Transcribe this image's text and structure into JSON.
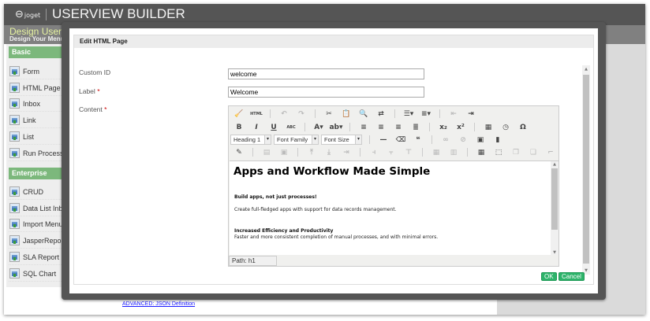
{
  "header": {
    "logo_text": "joget",
    "title": "USERVIEW BUILDER"
  },
  "subheader": {
    "title": "Design Userview",
    "subtitle": "Design Your Menu"
  },
  "sidebar": {
    "basic_label": "Basic",
    "basic_items": [
      {
        "label": "Form"
      },
      {
        "label": "HTML Page"
      },
      {
        "label": "Inbox"
      },
      {
        "label": "Link"
      },
      {
        "label": "List"
      },
      {
        "label": "Run Process"
      }
    ],
    "enterprise_label": "Enterprise",
    "enterprise_items": [
      {
        "label": "CRUD"
      },
      {
        "label": "Data List Inbox"
      },
      {
        "label": "Import Menu"
      },
      {
        "label": "JasperReports"
      },
      {
        "label": "SLA Report"
      },
      {
        "label": "SQL Chart"
      }
    ]
  },
  "advanced_link": "ADVANCED: JSON Definition",
  "dialog": {
    "title": "Edit HTML Page",
    "custom_id_label": "Custom ID",
    "custom_id_value": "welcome",
    "label_label": "Label",
    "label_value": "Welcome",
    "required_mark": "*",
    "content_label": "Content",
    "ok_label": "OK",
    "cancel_label": "Cancel"
  },
  "editor": {
    "toolbar_rows": [
      [
        {
          "icon": "cleanup-icon",
          "g": "🧹"
        },
        {
          "icon": "html-source-icon",
          "g": "HTML"
        },
        "|",
        {
          "icon": "undo-icon",
          "g": "↶",
          "dim": true
        },
        {
          "icon": "redo-icon",
          "g": "↷",
          "dim": true
        },
        "|",
        {
          "icon": "cut-icon",
          "g": "✂"
        },
        {
          "icon": "paste-icon",
          "g": "📋"
        },
        {
          "icon": "find-icon",
          "g": "🔍"
        },
        {
          "icon": "replace-icon",
          "g": "⇄"
        },
        "|",
        {
          "icon": "bullet-list-icon",
          "g": "☰▾"
        },
        {
          "icon": "numbered-list-icon",
          "g": "≡▾"
        },
        "|",
        {
          "icon": "outdent-icon",
          "g": "⇤",
          "dim": true
        },
        {
          "icon": "indent-icon",
          "g": "⇥"
        }
      ],
      [
        {
          "icon": "bold-icon",
          "g": "B"
        },
        {
          "icon": "italic-icon",
          "g": "I"
        },
        {
          "icon": "underline-icon",
          "g": "U"
        },
        {
          "icon": "strikethrough-icon",
          "g": "ABC"
        },
        "|",
        {
          "icon": "text-color-icon",
          "g": "A▾"
        },
        {
          "icon": "highlight-color-icon",
          "g": "ab▾"
        },
        "|",
        {
          "icon": "align-left-icon",
          "g": "≡"
        },
        {
          "icon": "align-center-icon",
          "g": "≡"
        },
        {
          "icon": "align-right-icon",
          "g": "≡"
        },
        {
          "icon": "align-justify-icon",
          "g": "≣"
        },
        "|",
        {
          "icon": "subscript-icon",
          "g": "x₂"
        },
        {
          "icon": "superscript-icon",
          "g": "x²"
        },
        "|",
        {
          "icon": "insert-date-icon",
          "g": "▦"
        },
        {
          "icon": "insert-time-icon",
          "g": "◷"
        },
        {
          "icon": "special-char-icon",
          "g": "Ω"
        }
      ],
      [
        "SEL:heading",
        "SEL:family",
        "SEL:size",
        "|",
        {
          "icon": "horizontal-rule-icon",
          "g": "—"
        },
        {
          "icon": "eraser-icon",
          "g": "⌫"
        },
        {
          "icon": "blockquote-icon",
          "g": "❝"
        },
        "|",
        {
          "icon": "link-icon",
          "g": "∞",
          "dim": true
        },
        {
          "icon": "unlink-icon",
          "g": "⊘",
          "dim": true
        },
        {
          "icon": "image-icon",
          "g": "▣"
        },
        {
          "icon": "media-icon",
          "g": "▮"
        }
      ],
      [
        {
          "icon": "edit-css-icon",
          "g": "✎"
        },
        "|",
        {
          "icon": "row-props-icon",
          "g": "▤",
          "dim": true
        },
        {
          "icon": "cell-props-icon",
          "g": "▣",
          "dim": true
        },
        "|",
        {
          "icon": "insert-row-before-icon",
          "g": "⤒",
          "dim": true
        },
        {
          "icon": "insert-row-after-icon",
          "g": "⤓",
          "dim": true
        },
        {
          "icon": "delete-row-icon",
          "g": "⇥",
          "dim": true
        },
        "|",
        {
          "icon": "insert-col-before-icon",
          "g": "⫞",
          "dim": true
        },
        {
          "icon": "insert-col-after-icon",
          "g": "⫟",
          "dim": true
        },
        {
          "icon": "delete-col-icon",
          "g": "⊤",
          "dim": true
        },
        "|",
        {
          "icon": "split-cells-icon",
          "g": "▦",
          "dim": true
        },
        {
          "icon": "merge-cells-icon",
          "g": "▥",
          "dim": true
        },
        "|",
        {
          "icon": "table-icon",
          "g": "▦"
        },
        {
          "icon": "visual-aid-icon",
          "g": "⬚"
        },
        {
          "icon": "layer-icon",
          "g": "❐",
          "dim": true
        },
        {
          "icon": "layer-move-icon",
          "g": "❏",
          "dim": true
        },
        {
          "icon": "absolute-icon",
          "g": "⌐",
          "dim": true
        }
      ]
    ],
    "heading_select": "Heading 1",
    "font_family_select": "Font Family",
    "font_size_select": "Font Size",
    "content": {
      "heading": "Apps and Workflow Made Simple",
      "p1_title": "Build apps, not just processes!",
      "p1_text": "Create full-fledged apps with support for data records management.",
      "p2_title": "Increased Efficiency and Productivity",
      "p2_text": "Faster and more consistent completion of manual processes, and with minimal errors."
    },
    "path": "Path: h1"
  }
}
